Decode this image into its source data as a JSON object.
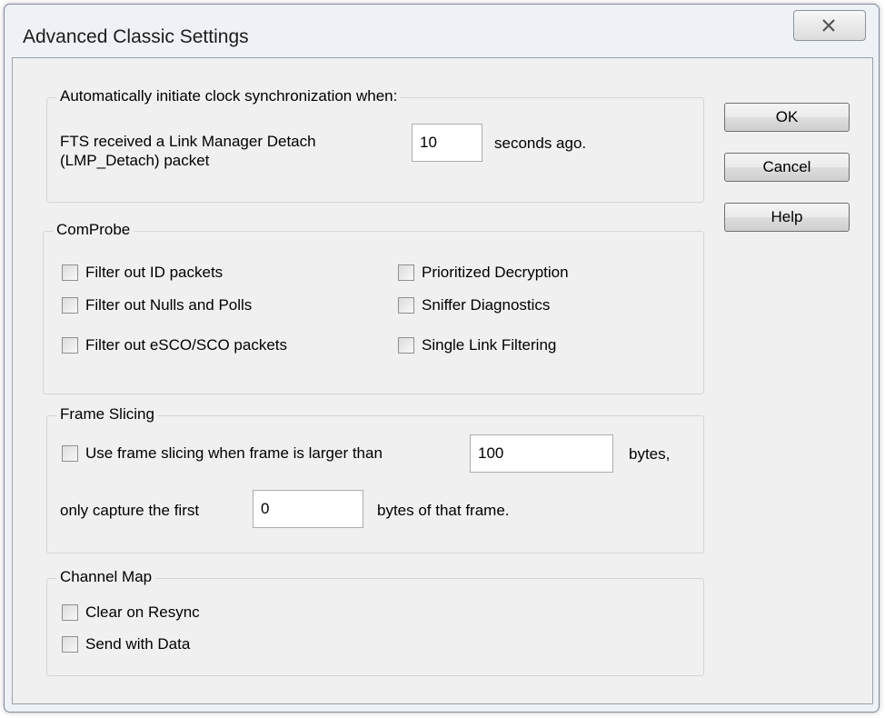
{
  "window": {
    "title": "Advanced Classic Settings"
  },
  "icons": {
    "close": "close-icon"
  },
  "buttons": {
    "ok": "OK",
    "cancel": "Cancel",
    "help": "Help"
  },
  "sync": {
    "group_label": "Automatically initiate clock synchronization when:",
    "line1": "FTS received a Link Manager Detach",
    "line2": "(LMP_Detach) packet",
    "seconds_value": "10",
    "suffix": "seconds ago."
  },
  "comprobe": {
    "group_label": "ComProbe",
    "filter_id": "Filter out ID packets",
    "filter_nulls": "Filter out Nulls and Polls",
    "filter_esco": "Filter out eSCO/SCO packets",
    "prioritized": "Prioritized Decryption",
    "sniffer": "Sniffer Diagnostics",
    "single_link": "Single Link Filtering"
  },
  "frame": {
    "group_label": "Frame Slicing",
    "use_slicing": "Use frame slicing when frame is larger than",
    "size_value": "100",
    "bytes_label": "bytes,",
    "capture_prefix": "only capture the first",
    "capture_value": "0",
    "capture_suffix": "bytes of that frame."
  },
  "channel": {
    "group_label": "Channel Map",
    "clear_resync": "Clear on Resync",
    "send_data": "Send with Data"
  }
}
